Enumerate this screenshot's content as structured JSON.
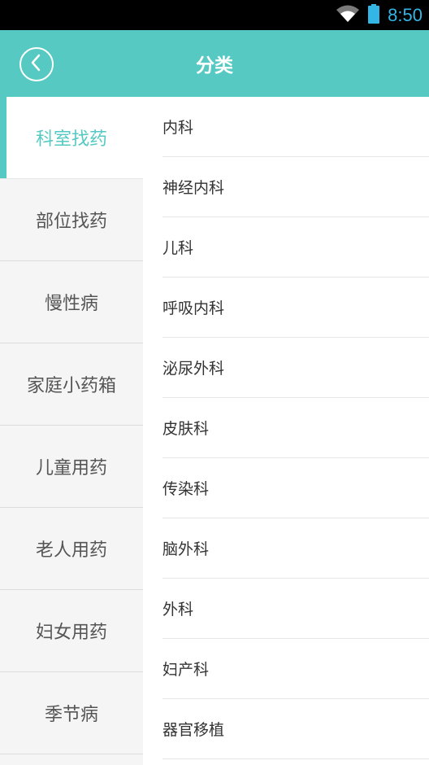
{
  "status_bar": {
    "time": "8:50",
    "icons": [
      "wifi-icon",
      "battery-icon"
    ],
    "accent_color": "#33b5e5"
  },
  "app_bar": {
    "title": "分类",
    "back_icon": "chevron-left-icon",
    "background_color": "#55c9c2"
  },
  "sidebar": {
    "items": [
      {
        "label": "科室找药",
        "active": true
      },
      {
        "label": "部位找药",
        "active": false
      },
      {
        "label": "慢性病",
        "active": false
      },
      {
        "label": "家庭小药箱",
        "active": false
      },
      {
        "label": "儿童用药",
        "active": false
      },
      {
        "label": "老人用药",
        "active": false
      },
      {
        "label": "妇女用药",
        "active": false
      },
      {
        "label": "季节病",
        "active": false
      }
    ]
  },
  "content": {
    "items": [
      {
        "label": "内科"
      },
      {
        "label": "神经内科"
      },
      {
        "label": "儿科"
      },
      {
        "label": "呼吸内科"
      },
      {
        "label": "泌尿外科"
      },
      {
        "label": "皮肤科"
      },
      {
        "label": "传染科"
      },
      {
        "label": "脑外科"
      },
      {
        "label": "外科"
      },
      {
        "label": "妇产科"
      },
      {
        "label": "器官移植"
      }
    ]
  }
}
